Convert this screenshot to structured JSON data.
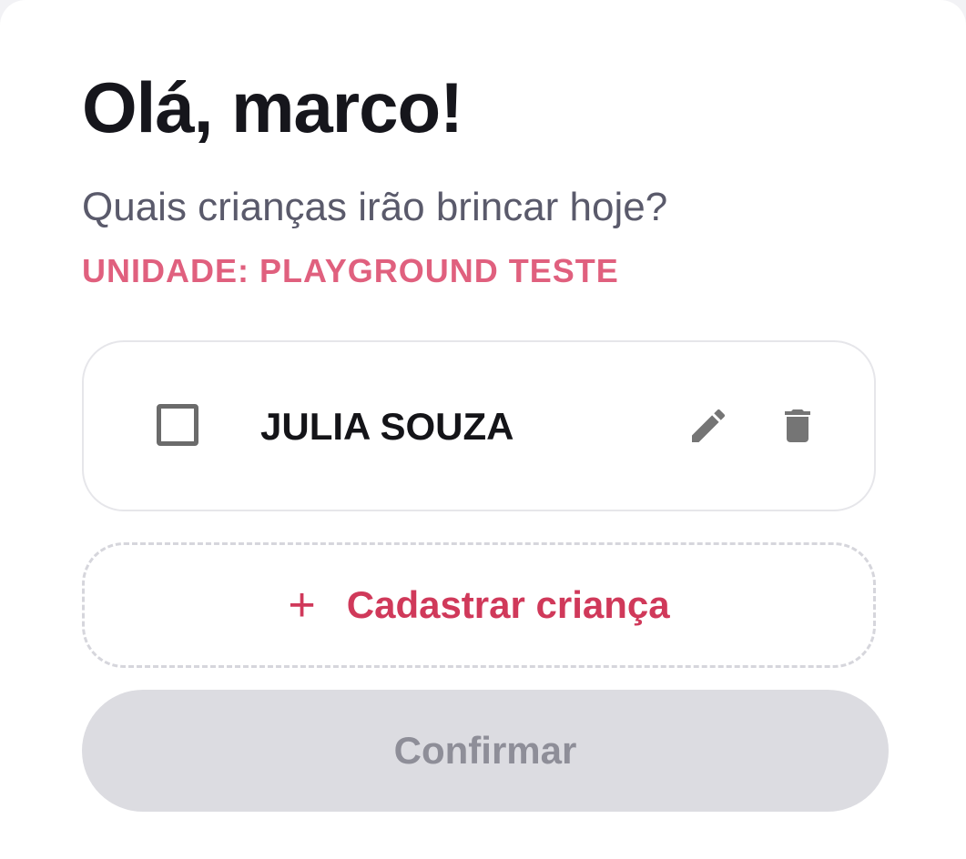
{
  "header": {
    "greeting": "Olá, marco!",
    "subtitle": "Quais crianças irão brincar hoje?",
    "unit_label": "UNIDADE: PLAYGROUND TESTE"
  },
  "children": [
    {
      "name": "JULIA SOUZA",
      "checked": false,
      "edit_icon": "pencil-icon",
      "delete_icon": "trash-icon"
    }
  ],
  "add_child": {
    "icon": "plus-icon",
    "plus_glyph": "+",
    "label": "Cadastrar criança"
  },
  "confirm": {
    "label": "Confirmar",
    "enabled": false
  },
  "colors": {
    "accent": "#d0395a",
    "unit_label": "#e0607e",
    "title": "#16161c",
    "subtitle": "#5a5a6b",
    "icon": "#757575",
    "disabled_bg": "#dcdce1",
    "disabled_text": "#8e8e98"
  }
}
